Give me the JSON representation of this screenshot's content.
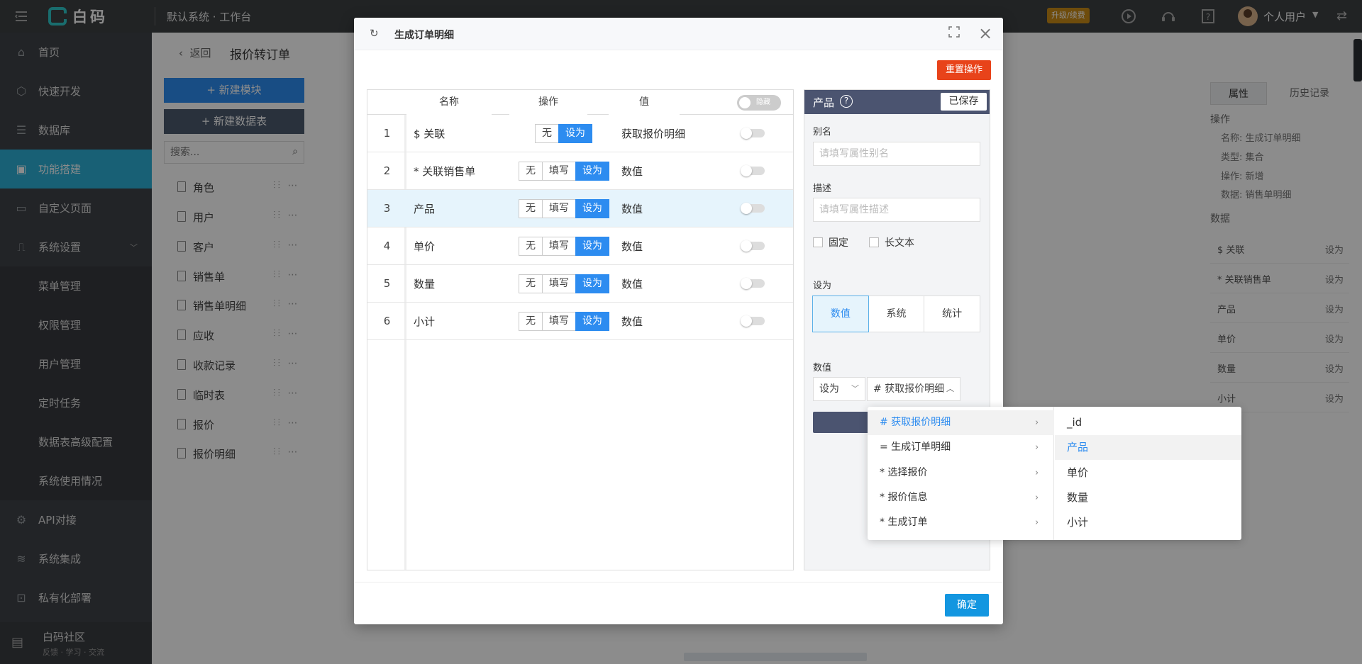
{
  "topbar": {
    "logo_text": "白码",
    "system_title": "默认系统 · 工作台",
    "upgrade_badge": "升级/续费",
    "user_name": "个人用户"
  },
  "sidebar": {
    "items": [
      {
        "label": "首页",
        "icon": "home-icon"
      },
      {
        "label": "快速开发",
        "icon": "cube-icon"
      },
      {
        "label": "数据库",
        "icon": "database-icon"
      },
      {
        "label": "功能搭建",
        "icon": "monitor-icon"
      },
      {
        "label": "自定义页面",
        "icon": "page-icon"
      },
      {
        "label": "系统设置",
        "icon": "chart-icon"
      },
      {
        "label": "菜单管理"
      },
      {
        "label": "权限管理"
      },
      {
        "label": "用户管理"
      },
      {
        "label": "定时任务"
      },
      {
        "label": "数据表高级配置"
      },
      {
        "label": "系统使用情况"
      },
      {
        "label": "API对接",
        "icon": "api-icon"
      },
      {
        "label": "系统集成",
        "icon": "layers-icon"
      },
      {
        "label": "私有化部署",
        "icon": "lock-icon"
      }
    ],
    "community_title": "白码社区",
    "community_sub": "反馈 · 学习 · 交流"
  },
  "page": {
    "back": "返回",
    "title": "报价转订单",
    "new_module": "+ 新建模块",
    "new_table": "+ 新建数据表",
    "search_placeholder": "搜索...",
    "modules": [
      "角色",
      "用户",
      "客户",
      "销售单",
      "销售单明细",
      "应收",
      "收款记录",
      "临时表",
      "报价",
      "报价明细"
    ]
  },
  "right_panel": {
    "tab_props": "属性",
    "tab_history": "历史记录",
    "ops_title": "操作",
    "props": [
      "名称: 生成订单明细",
      "类型: 集合",
      "操作: 新增",
      "数据: 销售单明细"
    ],
    "data_title": "数据",
    "data_rows": [
      {
        "k": "$ 关联",
        "v": "设为"
      },
      {
        "k": "* 关联销售单",
        "v": "设为"
      },
      {
        "k": "产品",
        "v": "设为"
      },
      {
        "k": "单价",
        "v": "设为"
      },
      {
        "k": "数量",
        "v": "设为"
      },
      {
        "k": "小计",
        "v": "设为"
      }
    ]
  },
  "modal": {
    "title": "生成订单明细",
    "reset": "重置操作",
    "headers": {
      "name": "名称",
      "op": "操作",
      "value": "值",
      "toggle": "隐藏"
    },
    "rows": [
      {
        "num": "1",
        "name": "$ 关联",
        "ops": [
          "无",
          "设为"
        ],
        "selected": "设为",
        "value": "获取报价明细"
      },
      {
        "num": "2",
        "name": "* 关联销售单",
        "ops": [
          "无",
          "填写",
          "设为"
        ],
        "selected": "设为",
        "value": "数值"
      },
      {
        "num": "3",
        "name": "产品",
        "ops": [
          "无",
          "填写",
          "设为"
        ],
        "selected": "设为",
        "value": "数值"
      },
      {
        "num": "4",
        "name": "单价",
        "ops": [
          "无",
          "填写",
          "设为"
        ],
        "selected": "设为",
        "value": "数值"
      },
      {
        "num": "5",
        "name": "数量",
        "ops": [
          "无",
          "填写",
          "设为"
        ],
        "selected": "设为",
        "value": "数值"
      },
      {
        "num": "6",
        "name": "小计",
        "ops": [
          "无",
          "填写",
          "设为"
        ],
        "selected": "设为",
        "value": "数值"
      }
    ],
    "prop": {
      "title": "产品",
      "saved": "已保存",
      "alias_label": "别名",
      "alias_placeholder": "请填写属性别名",
      "desc_label": "描述",
      "desc_placeholder": "请填写属性描述",
      "fixed": "固定",
      "long_text": "长文本",
      "setas_label": "设为",
      "setas_options": [
        "数值",
        "系统",
        "统计"
      ],
      "setas_selected": "数值",
      "numval_label": "数值",
      "numval_select": "设为",
      "numval_field": "# 获取报价明细"
    },
    "ok": "确定"
  },
  "cascader": {
    "left": [
      {
        "label": "# 获取报价明细",
        "active": true
      },
      {
        "label": "= 生成订单明细"
      },
      {
        "label": "* 选择报价"
      },
      {
        "label": "* 报价信息"
      },
      {
        "label": "* 生成订单"
      }
    ],
    "right": [
      {
        "label": "_id"
      },
      {
        "label": "产品",
        "active": true
      },
      {
        "label": "单价"
      },
      {
        "label": "数量"
      },
      {
        "label": "小计"
      }
    ]
  },
  "colors": {
    "primary": "#2d8cf0",
    "active_nav": "#2db0d6",
    "reset": "#e8431a",
    "ok": "#1396e0"
  }
}
